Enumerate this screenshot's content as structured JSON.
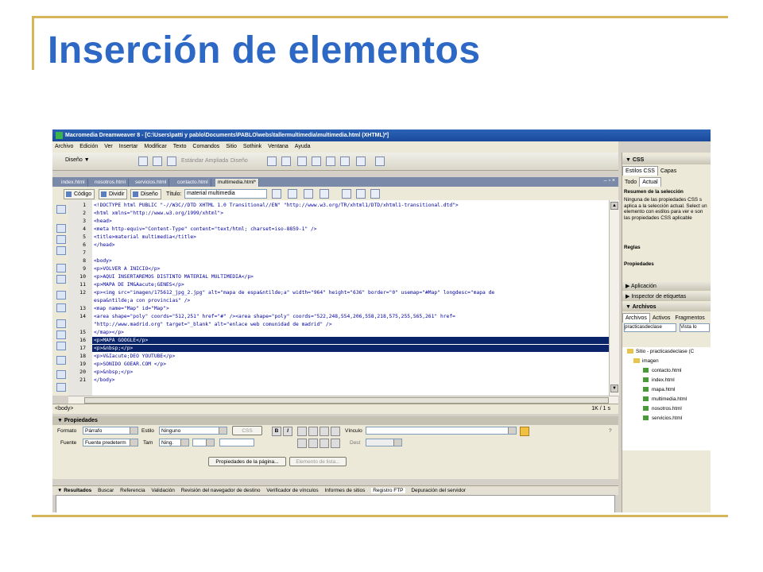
{
  "slide": {
    "title": "Inserción de elementos"
  },
  "window": {
    "title": "Macromedia Dreamweaver 8 - [C:\\Users\\patti y pablo\\Documents\\PABLO\\webs\\tallermultimedia\\multimedia.html (XHTML)*]"
  },
  "menu": [
    "Archivo",
    "Edición",
    "Ver",
    "Insertar",
    "Modificar",
    "Texto",
    "Comandos",
    "Sitio",
    "Sothink",
    "Ventana",
    "Ayuda"
  ],
  "toolbar": {
    "mode": "Diseño ▼",
    "estandar": "Estándar",
    "ampliada": "Ampliada",
    "diseno": "Diseño"
  },
  "doc_tabs": [
    "index.html",
    "nosotros.html",
    "servicios.html",
    "contacto.html",
    "multimedia.html*"
  ],
  "doc_tabs_winctl": "– ▫ ×",
  "view_bar": {
    "code": "Código",
    "split": "Dividir",
    "design": "Diseño",
    "title_label": "Título:",
    "title_value": "material multimedia"
  },
  "code_lines": [
    {
      "n": "1",
      "text": "<!DOCTYPE html PUBLIC \"-//W3C//DTD XHTML 1.0 Transitional//EN\" \"http://www.w3.org/TR/xhtml1/DTD/xhtml1-transitional.dtd\">"
    },
    {
      "n": "2",
      "text": "<html xmlns=\"http://www.w3.org/1999/xhtml\">"
    },
    {
      "n": "3",
      "text": "<head>"
    },
    {
      "n": "4",
      "text": "<meta http-equiv=\"Content-Type\" content=\"text/html; charset=iso-8859-1\" />"
    },
    {
      "n": "5",
      "text": "<title>material multimedia</title>"
    },
    {
      "n": "6",
      "text": "</head>"
    },
    {
      "n": "7",
      "text": ""
    },
    {
      "n": "8",
      "text": "<body>"
    },
    {
      "n": "9",
      "text": "<p>VOLVER A INICIO</p>"
    },
    {
      "n": "10",
      "text": "<p>AQUI INSERTAREMOS DISTINTO MATERIAL MULTIMEDIA</p>"
    },
    {
      "n": "11",
      "text": "<p>MAPA DE IM&Aacute;GENES</p>"
    },
    {
      "n": "12",
      "text": "<p><img src=\"imagen/175612_jpg_2.jpg\" alt=\"mapa de espa&ntilde;a\" width=\"964\" height=\"636\" border=\"0\" usemap=\"#Map\" longdesc=\"mapa de"
    },
    {
      "n": "",
      "text": "espa&ntilde;a con provincias\" />"
    },
    {
      "n": "13",
      "text": "<map name=\"Map\" id=\"Map\">"
    },
    {
      "n": "14",
      "text": "<area shape=\"poly\" coords=\"512,251\" href=\"#\" /><area shape=\"poly\" coords=\"522,248,554,206,558,218,575,255,565,261\" href="
    },
    {
      "n": "",
      "text": "\"http://www.madrid.org\" target=\"_blank\" alt=\"enlace web comunidad de madrid\" />"
    },
    {
      "n": "15",
      "text": "</map></p>"
    },
    {
      "n": "16",
      "text": "<p>MAPA GOOGLE</p>",
      "selected": true
    },
    {
      "n": "17",
      "text": "<p>&nbsp;</p>",
      "selected": true
    },
    {
      "n": "18",
      "text": "<p>V&Iacute;DEO YOUTUBE</p>"
    },
    {
      "n": "19",
      "text": "<p>SONIDO GOEAR.COM </p>"
    },
    {
      "n": "20",
      "text": "<p>&nbsp;</p>"
    },
    {
      "n": "21",
      "text": "</body>"
    }
  ],
  "status": {
    "tag": "<body>",
    "size": "1K / 1 s"
  },
  "properties": {
    "header": "▼ Propiedades",
    "formato_label": "Formato",
    "formato_value": "Párrafo",
    "estilo_label": "Estilo",
    "estilo_value": "Ninguno",
    "css_button": "CSS",
    "vinculo_label": "Vínculo",
    "fuente_label": "Fuente",
    "fuente_value": "Fuente predeterm",
    "tam_label": "Tam",
    "tam_value": "Ning.",
    "dest_label": "Dest",
    "page_props_button": "Propiedades de la página...",
    "list_item_button": "Elemento de lista..."
  },
  "results": {
    "header": "▼ Resultados",
    "tabs": [
      "Buscar",
      "Referencia",
      "Validación",
      "Revisión del navegador de destino",
      "Verificador de vínculos",
      "Informes de sitios",
      "Registro FTP",
      "Depuración del servidor"
    ],
    "active_tab": "Registro FTP"
  },
  "css_panel": {
    "header": "▼ CSS",
    "tabs": [
      "Estilos CSS",
      "Capas"
    ],
    "mode_tabs": [
      "Todo",
      "Actual"
    ],
    "summary_title": "Resumen de la selección",
    "summary_text": "Ninguna de las propiedades CSS s aplica a la selección actual. Select un elemento con estilos para ver e son las propiedades CSS aplicable",
    "rules_label": "Reglas",
    "props_label": "Propiedades"
  },
  "collapsed_panels": [
    "▶ Aplicación",
    "▶ Inspector de etiquetas"
  ],
  "files_panel": {
    "header": "▼ Archivos",
    "tabs": [
      "Archivos",
      "Activos",
      "Fragmentos"
    ],
    "site_select": "practicasdeclase",
    "view_select": "Vista lo",
    "root": "Sitio - practicasdeclase (C",
    "items": [
      "imagen",
      "contacto.html",
      "index.html",
      "mapa.html",
      "multimedia.html",
      "nosotros.html",
      "servicios.html"
    ]
  },
  "colors": {
    "title": "#2d68c4",
    "accent_line": "#d7b65a",
    "selection": "#0a246a",
    "titlebar": "#2b63b8"
  }
}
